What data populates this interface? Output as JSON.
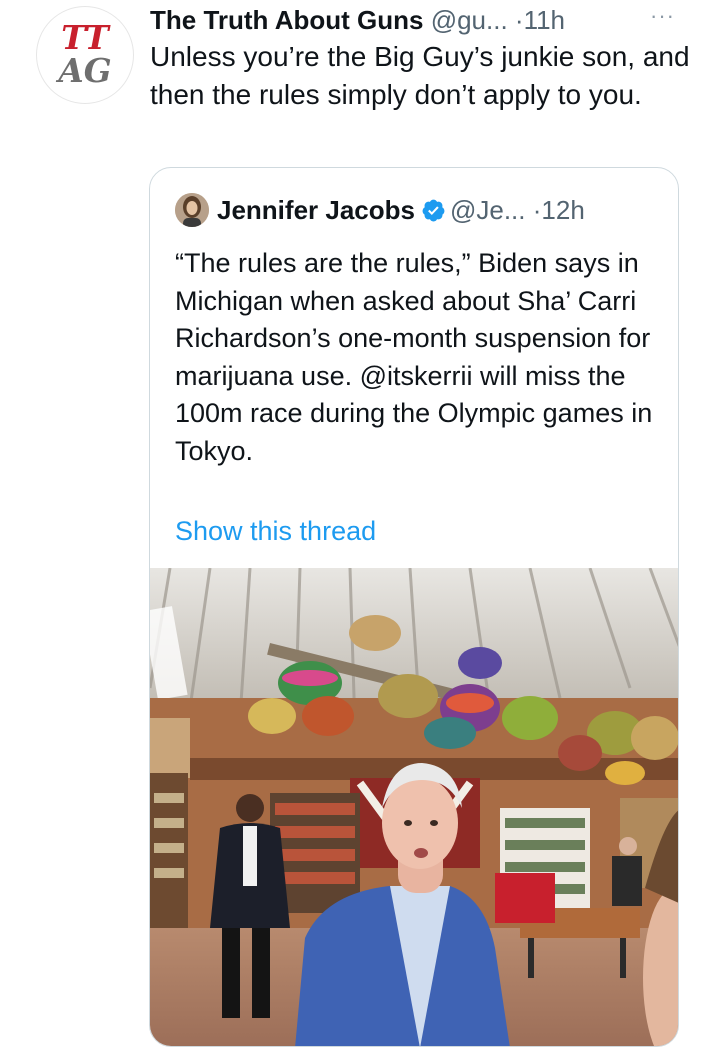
{
  "tweet": {
    "author_name": "The Truth About Guns",
    "author_handle": "@gu...",
    "separator": " ·",
    "time": "11h",
    "more": "···",
    "text": "Unless you’re the Big Guy’s junkie son, and then the rules simply don’t apply to you.",
    "avatar_logo_text": "TTAG"
  },
  "quoted": {
    "author_name": "Jennifer Jacobs",
    "author_handle": "@Je...",
    "separator": " ·",
    "time": "12h",
    "text": "“The rules are the rules,” Biden says in Michigan when asked about Sha’ Carri Richardson’s one-month suspension for marijuana use. @itskerrii will miss the 100m race during the Olympic games in Tokyo.",
    "show_thread": "Show this thread",
    "verified_icon": "verified-badge-icon"
  },
  "colors": {
    "text": "#0f1419",
    "secondary": "#536471",
    "link": "#1d9bf0",
    "logo_red": "#c8202d",
    "logo_gray": "#6e6e6e"
  }
}
